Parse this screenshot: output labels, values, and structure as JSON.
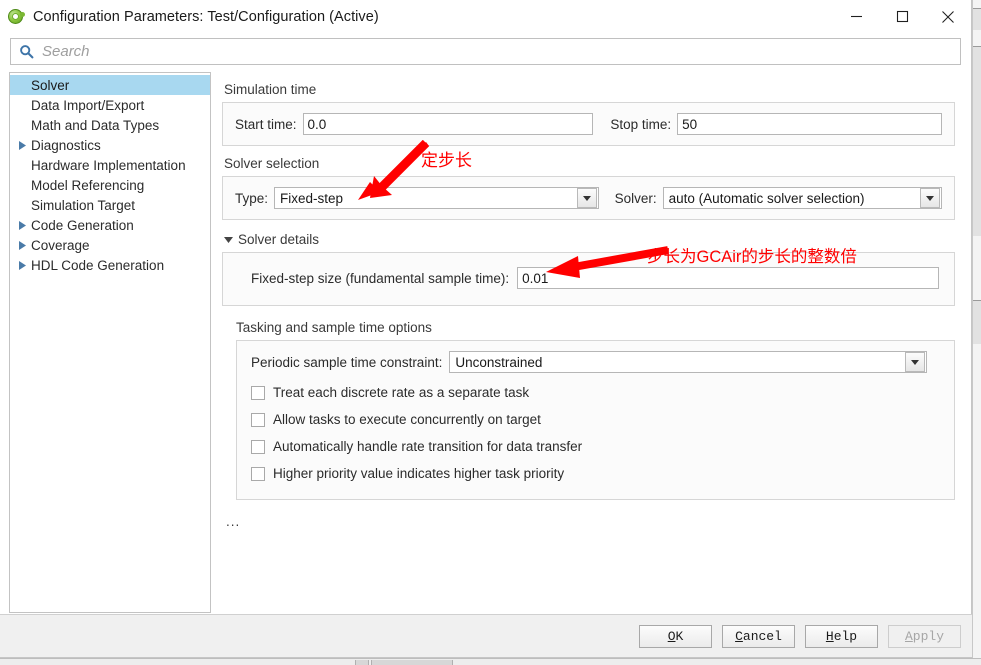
{
  "window": {
    "title": "Configuration Parameters: Test/Configuration (Active)",
    "app_icon": "simulink-icon",
    "minimize_icon": "minimize-icon",
    "maximize_icon": "maximize-icon",
    "close_icon": "close-icon"
  },
  "search": {
    "placeholder": "Search",
    "value": "",
    "icon": "search-icon"
  },
  "sidebar": {
    "items": [
      {
        "label": "Solver",
        "expandable": false,
        "selected": true
      },
      {
        "label": "Data Import/Export",
        "expandable": false,
        "selected": false
      },
      {
        "label": "Math and Data Types",
        "expandable": false,
        "selected": false
      },
      {
        "label": "Diagnostics",
        "expandable": true,
        "selected": false
      },
      {
        "label": "Hardware Implementation",
        "expandable": false,
        "selected": false
      },
      {
        "label": "Model Referencing",
        "expandable": false,
        "selected": false
      },
      {
        "label": "Simulation Target",
        "expandable": false,
        "selected": false
      },
      {
        "label": "Code Generation",
        "expandable": true,
        "selected": false
      },
      {
        "label": "Coverage",
        "expandable": true,
        "selected": false
      },
      {
        "label": "HDL Code Generation",
        "expandable": true,
        "selected": false
      }
    ]
  },
  "main": {
    "simulation_time": {
      "heading": "Simulation time",
      "start_time_label": "Start time:",
      "start_time_value": "0.0",
      "stop_time_label": "Stop time:",
      "stop_time_value": "50"
    },
    "solver_selection": {
      "heading": "Solver selection",
      "type_label": "Type:",
      "type_value": "Fixed-step",
      "solver_label": "Solver:",
      "solver_value": "auto (Automatic solver selection)"
    },
    "solver_details": {
      "heading": "Solver details",
      "expanded": true,
      "fixed_step_label": "Fixed-step size (fundamental sample time):",
      "fixed_step_value": "0.01"
    },
    "tasking": {
      "heading": "Tasking and sample time options",
      "constraint_label": "Periodic sample time constraint:",
      "constraint_value": "Unconstrained",
      "checkboxes": [
        {
          "label": "Treat each discrete rate as a separate task",
          "checked": false
        },
        {
          "label": "Allow tasks to execute concurrently on target",
          "checked": false
        },
        {
          "label": "Automatically handle rate transition for data transfer",
          "checked": false
        },
        {
          "label": "Higher priority value indicates higher task priority",
          "checked": false
        }
      ]
    },
    "more_button": "..."
  },
  "footer": {
    "buttons": [
      {
        "id": "ok",
        "pre": "",
        "mnemonic": "O",
        "post": "K",
        "disabled": false
      },
      {
        "id": "cancel",
        "pre": "",
        "mnemonic": "C",
        "post": "ancel",
        "disabled": false
      },
      {
        "id": "help",
        "pre": "",
        "mnemonic": "H",
        "post": "elp",
        "disabled": false
      },
      {
        "id": "apply",
        "pre": "",
        "mnemonic": "A",
        "post": "pply",
        "disabled": true
      }
    ]
  },
  "annotations": {
    "color": "#ff0000",
    "items": [
      {
        "id": "fixed-step-note",
        "text": "定步长"
      },
      {
        "id": "gcair-note",
        "text": "步长为GCAir的步长的整数倍"
      }
    ]
  }
}
